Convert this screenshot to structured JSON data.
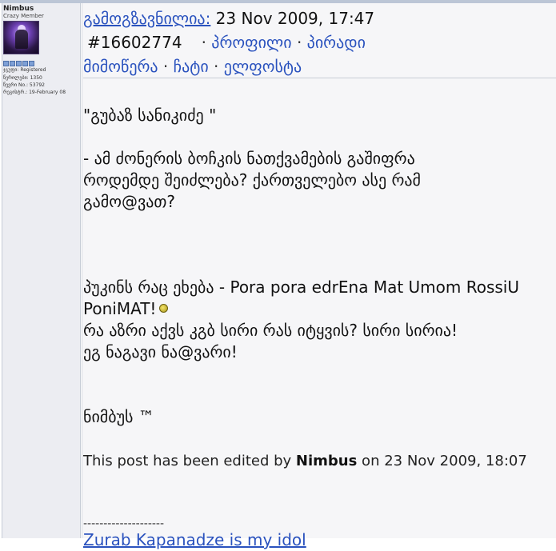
{
  "user": {
    "name": "Nimbus",
    "title": "Crazy Member",
    "group": "ჯგუფი: Registered",
    "posts": "წერილები: 1350",
    "member_no": "წევრი No.: 53792",
    "registered": "რეგისტრ.: 19-February 08",
    "rank_pips": 5
  },
  "post": {
    "sent_label": "გამოგზავნილია:",
    "date": " 23 Nov 2009, 17:47",
    "post_id": "#16602774",
    "links": {
      "profile": "პროფილი",
      "private": "პირადი",
      "private_cont": "მიმოწერა",
      "chat": "ჩატი",
      "email": "ელფოსტა"
    },
    "body": [
      "\"გუბაზ სანიკიძე \"",
      "- ამ ძონერის ბოჩკის ნათქვამების გაშიფრა",
      "როდემდე შეიძლება? ქართველებო ასე რამ",
      "გამო@ვათ?",
      "პუკინს რაც ეხება - Pora pora edrEna Mat Umom RossiU",
      "PoniMAT!",
      "რა აზრი აქვს კგბ სირი რას იტყვის? სირი სირია!",
      "ეგ ნაგავი ნა@ვარი!",
      "ნიმბუს ™"
    ],
    "edited_prefix": "This post has been edited by ",
    "edited_by": "Nimbus",
    "edited_suffix": " on 23 Nov 2009, 18:07",
    "signature_sep": "--------------------",
    "signature_link": "Zurab Kapanadze is my idol"
  }
}
